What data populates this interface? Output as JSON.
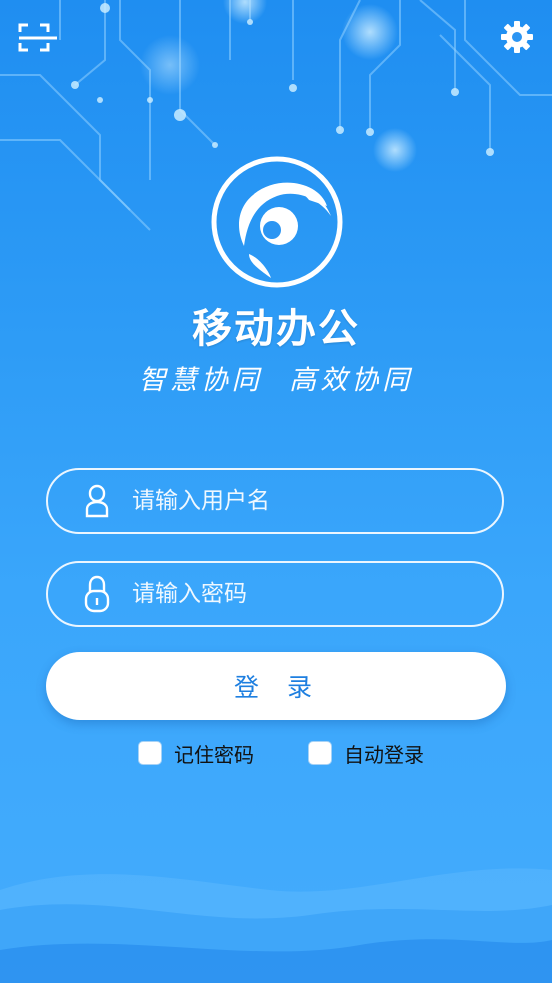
{
  "header": {
    "scan_icon": "scan-icon",
    "settings_icon": "gear-icon"
  },
  "branding": {
    "logo_icon": "app-logo-icon",
    "title": "移动办公",
    "slogan": "智慧协同 高效协同"
  },
  "form": {
    "username": {
      "placeholder": "请输入用户名",
      "value": "",
      "icon": "user-icon"
    },
    "password": {
      "placeholder": "请输入密码",
      "value": "",
      "icon": "lock-icon"
    },
    "login_label": "登 录",
    "remember_password_label": "记住密码",
    "remember_password_checked": false,
    "auto_login_label": "自动登录",
    "auto_login_checked": false
  },
  "colors": {
    "background_top": "#1f8ef1",
    "background_bottom": "#44acfd",
    "button_text": "#1e7fe0",
    "white": "#ffffff"
  }
}
